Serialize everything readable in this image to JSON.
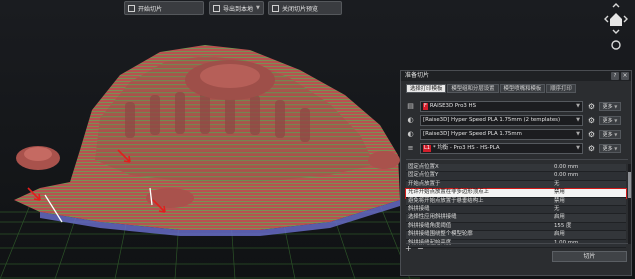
{
  "toolbar": {
    "start_slice": "开始切片",
    "export_to_local": "导出到本地",
    "close_slice_preview": "关闭切片预览"
  },
  "view_controls": {
    "up": "up-arrow-icon",
    "home": "home-icon",
    "left": "left-arrow-icon",
    "right": "right-arrow-icon",
    "down": "down-arrow-icon",
    "bottom": "rotate-icon"
  },
  "dialog": {
    "title": "准备切片",
    "help": "?",
    "close": "×",
    "tabs": [
      {
        "label": "选择打印模板",
        "active": true
      },
      {
        "label": "模型组和分层设置",
        "active": false
      },
      {
        "label": "模型喷嘴和模板",
        "active": false
      },
      {
        "label": "顺序打印",
        "active": false
      }
    ],
    "presets": [
      {
        "icon": "printer-icon",
        "badge": "F",
        "text": "RAISE3D Pro3 HS",
        "more": "更多"
      },
      {
        "icon": "filament-icon",
        "badge": "",
        "text": "[Raise3D] Hyper Speed PLA 1.75mm (2 templates)",
        "more": "更多"
      },
      {
        "icon": "filament-icon",
        "badge": "",
        "text": "[Raise3D] Hyper Speed PLA 1.75mm",
        "more": "更多"
      },
      {
        "icon": "layers-icon",
        "badge": "L1",
        "text": "* 均衡 - Pro3 HS - HS-PLA",
        "more": "更多"
      }
    ],
    "settings": [
      {
        "key": "固定点位置X",
        "value": "0.00 mm",
        "highlight": false
      },
      {
        "key": "固定点位置Y",
        "value": "0.00 mm",
        "highlight": false
      },
      {
        "key": "开始点放置于",
        "value": "无",
        "highlight": false
      },
      {
        "key": "允许开始点放置在非多边形顶点上",
        "value": "禁用",
        "highlight": true
      },
      {
        "key": "避免将开始点放置于悬垂结构上",
        "value": "禁用",
        "highlight": false
      },
      {
        "key": "斜拼接缝",
        "value": "无",
        "highlight": false
      },
      {
        "key": "选择性应用斜拼接缝",
        "value": "启用",
        "highlight": false
      },
      {
        "key": "斜拼接缝角度阈值",
        "value": "155 度",
        "highlight": false
      },
      {
        "key": "斜拼接缝围绕整个模型轮廓",
        "value": "启用",
        "highlight": false
      },
      {
        "key": "斜拼接缝起始高度",
        "value": "1.00 mm",
        "highlight": false
      }
    ],
    "plus": "+",
    "minus": "−",
    "slice_button": "切片"
  },
  "colors": {
    "model_red": "#b65350",
    "model_green": "#7a8f54",
    "plate_grid": "#2f5a2a",
    "highlight_outline": "#d11a1a"
  }
}
